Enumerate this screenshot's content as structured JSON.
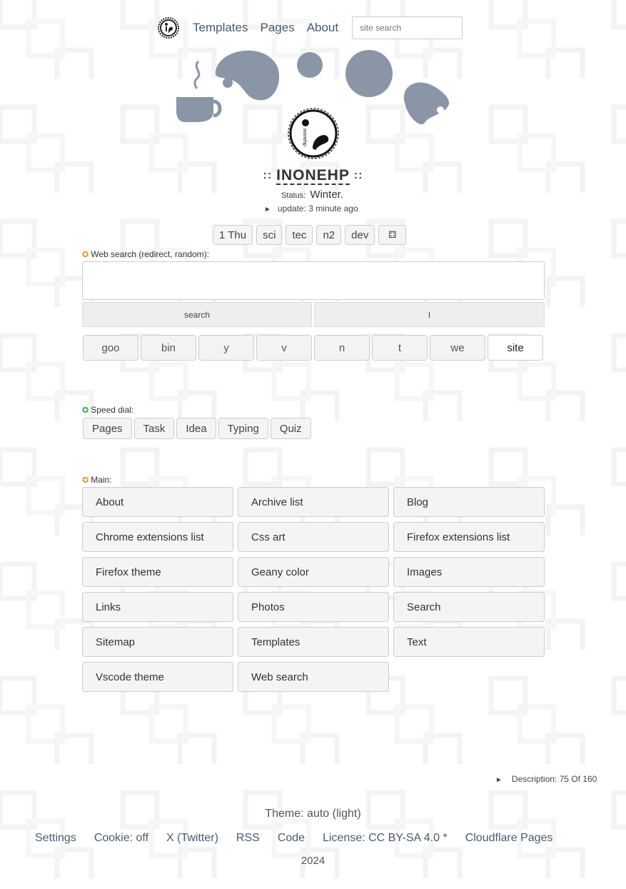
{
  "nav": {
    "logo_icon": "inonehp-logo-icon",
    "links": [
      "Templates",
      "Pages",
      "About"
    ],
    "search_placeholder": "site search"
  },
  "site": {
    "logo_icon": "inonehp-badge-icon",
    "title_prefix": "::",
    "title": "INONEHP",
    "title_suffix": "::",
    "status_label": "Status:",
    "status_value": "Winter.",
    "update": "update: 3 minute ago"
  },
  "tags": [
    "1 Thu",
    "sci",
    "tec",
    "n2",
    "dev",
    "⚃"
  ],
  "web_search": {
    "label": "Web search (redirect, random):",
    "search_button": "search",
    "lucky_button": "l",
    "engines": [
      "goo",
      "bin",
      "y",
      "v",
      "n",
      "t",
      "we",
      "site"
    ],
    "active_engine": "site"
  },
  "speed_dial": {
    "label": "Speed dial:",
    "items": [
      "Pages",
      "Task",
      "Idea",
      "Typing",
      "Quiz"
    ]
  },
  "main": {
    "label": "Main:",
    "items": [
      "About",
      "Archive list",
      "Blog",
      "Chrome extensions list",
      "Css art",
      "Firefox extensions list",
      "Firefox theme",
      "Geany color",
      "Images",
      "Links",
      "Photos",
      "Search",
      "Sitemap",
      "Templates",
      "Text",
      "Vscode theme",
      "Web search"
    ]
  },
  "description": "Description: 75 Of 160",
  "theme": "Theme: auto (light)",
  "footer": {
    "links": [
      "Settings",
      "Cookie: off",
      "X (Twitter)",
      "RSS",
      "Code",
      "License: CC BY-SA 4.0 *",
      "Cloudflare Pages"
    ],
    "year": "2024"
  },
  "colors": {
    "accent": "#4a5a6e",
    "shape": "#8a95a6",
    "star_orange": "#e08a10",
    "star_green": "#2a9a3a"
  }
}
